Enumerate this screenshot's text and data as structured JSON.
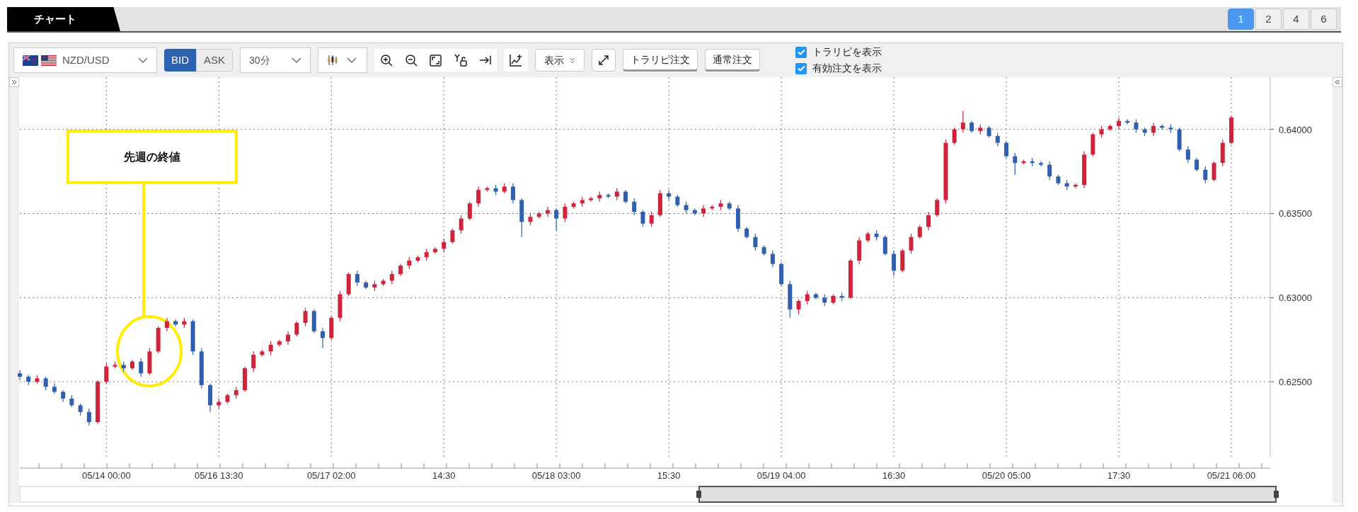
{
  "tab": {
    "label": "チャート"
  },
  "layout_buttons": [
    {
      "label": "1",
      "selected": true
    },
    {
      "label": "2",
      "selected": false
    },
    {
      "label": "4",
      "selected": false
    },
    {
      "label": "6",
      "selected": false
    }
  ],
  "toolbar": {
    "symbol": "NZD/USD",
    "price_side": [
      {
        "label": "BID",
        "selected": true
      },
      {
        "label": "ASK",
        "selected": false
      }
    ],
    "timeframe": "30分",
    "display_button": "表示",
    "order_buttons": [
      "トラリピ注文",
      "通常注文"
    ],
    "checkboxes": [
      {
        "label": "トラリピを表示",
        "checked": true
      },
      {
        "label": "有効注文を表示",
        "checked": true
      }
    ]
  },
  "chart": {
    "annotation": {
      "text": "先週の終値"
    },
    "chart_data": {
      "type": "candlestick",
      "ylim": [
        0.6205,
        0.6431
      ],
      "grid": true,
      "yticks": [
        {
          "value": 0.64,
          "label": "0.64000"
        },
        {
          "value": 0.635,
          "label": "0.63500"
        },
        {
          "value": 0.63,
          "label": "0.63000"
        },
        {
          "value": 0.625,
          "label": "0.62500"
        }
      ],
      "categories": [
        null,
        null,
        null,
        null,
        null,
        null,
        null,
        null,
        null,
        null,
        "05/14 00:00",
        null,
        null,
        null,
        null,
        null,
        null,
        null,
        null,
        null,
        null,
        null,
        null,
        "05/16 13:30",
        null,
        null,
        null,
        null,
        null,
        null,
        null,
        null,
        null,
        null,
        null,
        null,
        "05/17 02:00",
        null,
        null,
        null,
        null,
        null,
        null,
        null,
        null,
        null,
        null,
        null,
        null,
        "14:30",
        null,
        null,
        null,
        null,
        null,
        null,
        null,
        null,
        null,
        null,
        null,
        null,
        "05/18 03:00",
        null,
        null,
        null,
        null,
        null,
        null,
        null,
        null,
        null,
        null,
        null,
        null,
        "15:30",
        null,
        null,
        null,
        null,
        null,
        null,
        null,
        null,
        null,
        null,
        null,
        null,
        "05/19 04:00",
        null,
        null,
        null,
        null,
        null,
        null,
        null,
        null,
        null,
        null,
        null,
        null,
        "16:30",
        null,
        null,
        null,
        null,
        null,
        null,
        null,
        null,
        null,
        null,
        null,
        null,
        "05/20 05:00",
        null,
        null,
        null,
        null,
        null,
        null,
        null,
        null,
        null,
        null,
        null,
        null,
        "17:30",
        null,
        null,
        null,
        null,
        null,
        null,
        null,
        null,
        null,
        null,
        null,
        null,
        "05/21 06:00"
      ],
      "ohlc": [
        [
          0.6255,
          0.6257,
          0.6251,
          0.6253
        ],
        [
          0.6253,
          0.6254,
          0.6248,
          0.625
        ],
        [
          0.625,
          0.6254,
          0.6249,
          0.6252
        ],
        [
          0.6252,
          0.6253,
          0.6245,
          0.6247
        ],
        [
          0.6247,
          0.6249,
          0.6243,
          0.6244
        ],
        [
          0.6244,
          0.6245,
          0.6238,
          0.624
        ],
        [
          0.624,
          0.6242,
          0.6235,
          0.6236
        ],
        [
          0.6236,
          0.6237,
          0.623,
          0.6232
        ],
        [
          0.6232,
          0.6234,
          0.6224,
          0.6226
        ],
        [
          0.6226,
          0.6251,
          0.6225,
          0.625
        ],
        [
          0.625,
          0.6261,
          0.6249,
          0.6259
        ],
        [
          0.6259,
          0.6262,
          0.6258,
          0.626
        ],
        [
          0.626,
          0.6262,
          0.6256,
          0.6258
        ],
        [
          0.6258,
          0.6263,
          0.6257,
          0.6262
        ],
        [
          0.6262,
          0.6264,
          0.6253,
          0.6255
        ],
        [
          0.6255,
          0.627,
          0.6254,
          0.6268
        ],
        [
          0.6268,
          0.6283,
          0.6267,
          0.6282
        ],
        [
          0.6282,
          0.6288,
          0.628,
          0.6286
        ],
        [
          0.6286,
          0.6287,
          0.6283,
          0.6284
        ],
        [
          0.6284,
          0.6288,
          0.6282,
          0.6286
        ],
        [
          0.6286,
          0.6287,
          0.6266,
          0.6268
        ],
        [
          0.6268,
          0.627,
          0.6246,
          0.6248
        ],
        [
          0.6248,
          0.6249,
          0.6232,
          0.6236
        ],
        [
          0.6236,
          0.624,
          0.6234,
          0.6238
        ],
        [
          0.6238,
          0.6243,
          0.6237,
          0.6242
        ],
        [
          0.6242,
          0.6247,
          0.624,
          0.6245
        ],
        [
          0.6245,
          0.6259,
          0.6244,
          0.6258
        ],
        [
          0.6258,
          0.6268,
          0.6256,
          0.6266
        ],
        [
          0.6266,
          0.6269,
          0.6265,
          0.6268
        ],
        [
          0.6268,
          0.6274,
          0.6266,
          0.6272
        ],
        [
          0.6272,
          0.6275,
          0.6271,
          0.6274
        ],
        [
          0.6274,
          0.628,
          0.6272,
          0.6278
        ],
        [
          0.6278,
          0.6286,
          0.6277,
          0.6285
        ],
        [
          0.6285,
          0.6294,
          0.6283,
          0.6292
        ],
        [
          0.6292,
          0.6293,
          0.6279,
          0.628
        ],
        [
          0.628,
          0.6282,
          0.627,
          0.6276
        ],
        [
          0.6276,
          0.6289,
          0.6275,
          0.6288
        ],
        [
          0.6288,
          0.6304,
          0.6286,
          0.6302
        ],
        [
          0.6302,
          0.6315,
          0.6301,
          0.6314
        ],
        [
          0.6314,
          0.6316,
          0.6307,
          0.6309
        ],
        [
          0.6309,
          0.631,
          0.6305,
          0.6306
        ],
        [
          0.6306,
          0.631,
          0.6304,
          0.6308
        ],
        [
          0.6308,
          0.6311,
          0.6307,
          0.631
        ],
        [
          0.631,
          0.6316,
          0.6308,
          0.6314
        ],
        [
          0.6314,
          0.632,
          0.6313,
          0.6319
        ],
        [
          0.6319,
          0.6324,
          0.6317,
          0.6322
        ],
        [
          0.6322,
          0.6325,
          0.6321,
          0.6324
        ],
        [
          0.6324,
          0.6329,
          0.6322,
          0.6327
        ],
        [
          0.6327,
          0.633,
          0.6326,
          0.6329
        ],
        [
          0.6329,
          0.6335,
          0.6327,
          0.6333
        ],
        [
          0.6333,
          0.6341,
          0.6332,
          0.634
        ],
        [
          0.634,
          0.6349,
          0.6338,
          0.6347
        ],
        [
          0.6347,
          0.6357,
          0.6346,
          0.6356
        ],
        [
          0.6356,
          0.6366,
          0.6354,
          0.6364
        ],
        [
          0.6364,
          0.6366,
          0.6363,
          0.6365
        ],
        [
          0.6365,
          0.6367,
          0.6361,
          0.6363
        ],
        [
          0.6363,
          0.6368,
          0.6362,
          0.6366
        ],
        [
          0.6366,
          0.6368,
          0.6356,
          0.6358
        ],
        [
          0.6358,
          0.6359,
          0.6336,
          0.6345
        ],
        [
          0.6345,
          0.635,
          0.6343,
          0.6348
        ],
        [
          0.6348,
          0.6351,
          0.6347,
          0.635
        ],
        [
          0.635,
          0.6354,
          0.6348,
          0.6352
        ],
        [
          0.6352,
          0.6353,
          0.634,
          0.6347
        ],
        [
          0.6347,
          0.6356,
          0.6345,
          0.6354
        ],
        [
          0.6354,
          0.6357,
          0.6353,
          0.6356
        ],
        [
          0.6356,
          0.636,
          0.6354,
          0.6358
        ],
        [
          0.6358,
          0.636,
          0.6357,
          0.6359
        ],
        [
          0.6359,
          0.6363,
          0.6357,
          0.6361
        ],
        [
          0.6361,
          0.6362,
          0.6359,
          0.636
        ],
        [
          0.636,
          0.6365,
          0.6358,
          0.6363
        ],
        [
          0.6363,
          0.6364,
          0.6356,
          0.6357
        ],
        [
          0.6357,
          0.6359,
          0.6349,
          0.6351
        ],
        [
          0.6351,
          0.6352,
          0.6342,
          0.6344
        ],
        [
          0.6344,
          0.6351,
          0.6342,
          0.6349
        ],
        [
          0.6349,
          0.6364,
          0.6348,
          0.6362
        ],
        [
          0.6362,
          0.6364,
          0.6358,
          0.636
        ],
        [
          0.636,
          0.6361,
          0.6354,
          0.6355
        ],
        [
          0.6355,
          0.6357,
          0.635,
          0.6352
        ],
        [
          0.6352,
          0.6353,
          0.6349,
          0.635
        ],
        [
          0.635,
          0.6355,
          0.6348,
          0.6353
        ],
        [
          0.6353,
          0.6355,
          0.6352,
          0.6354
        ],
        [
          0.6354,
          0.6358,
          0.6352,
          0.6356
        ],
        [
          0.6356,
          0.6357,
          0.6352,
          0.6353
        ],
        [
          0.6353,
          0.6355,
          0.6339,
          0.6341
        ],
        [
          0.6341,
          0.6342,
          0.6335,
          0.6336
        ],
        [
          0.6336,
          0.6338,
          0.6328,
          0.633
        ],
        [
          0.633,
          0.6331,
          0.6325,
          0.6326
        ],
        [
          0.6326,
          0.6328,
          0.6318,
          0.632
        ],
        [
          0.632,
          0.6321,
          0.6307,
          0.6308
        ],
        [
          0.6308,
          0.631,
          0.6288,
          0.6293
        ],
        [
          0.6293,
          0.6299,
          0.629,
          0.6298
        ],
        [
          0.6298,
          0.6304,
          0.6296,
          0.6302
        ],
        [
          0.6302,
          0.6303,
          0.6299,
          0.63
        ],
        [
          0.63,
          0.6302,
          0.6295,
          0.6297
        ],
        [
          0.6297,
          0.6302,
          0.6296,
          0.6301
        ],
        [
          0.6301,
          0.6303,
          0.6298,
          0.63
        ],
        [
          0.63,
          0.6323,
          0.6299,
          0.6322
        ],
        [
          0.6322,
          0.6336,
          0.632,
          0.6334
        ],
        [
          0.6334,
          0.6339,
          0.6333,
          0.6338
        ],
        [
          0.6338,
          0.634,
          0.6334,
          0.6336
        ],
        [
          0.6336,
          0.6337,
          0.6325,
          0.6326
        ],
        [
          0.6326,
          0.6328,
          0.6313,
          0.6316
        ],
        [
          0.6316,
          0.6329,
          0.6315,
          0.6328
        ],
        [
          0.6328,
          0.6338,
          0.6326,
          0.6336
        ],
        [
          0.6336,
          0.6343,
          0.6335,
          0.6342
        ],
        [
          0.6342,
          0.6351,
          0.634,
          0.6349
        ],
        [
          0.6349,
          0.6359,
          0.6348,
          0.6358
        ],
        [
          0.6358,
          0.6394,
          0.6356,
          0.6392
        ],
        [
          0.6392,
          0.6401,
          0.6391,
          0.64
        ],
        [
          0.64,
          0.6411,
          0.6398,
          0.6404
        ],
        [
          0.6404,
          0.6405,
          0.6398,
          0.6399
        ],
        [
          0.6399,
          0.6403,
          0.6397,
          0.6401
        ],
        [
          0.6401,
          0.6402,
          0.6395,
          0.6396
        ],
        [
          0.6396,
          0.6398,
          0.639,
          0.6392
        ],
        [
          0.6392,
          0.6393,
          0.6383,
          0.6384
        ],
        [
          0.6384,
          0.6386,
          0.6373,
          0.638
        ],
        [
          0.638,
          0.6382,
          0.6379,
          0.6381
        ],
        [
          0.6381,
          0.6383,
          0.6378,
          0.638
        ],
        [
          0.638,
          0.6381,
          0.6378,
          0.6379
        ],
        [
          0.6379,
          0.6381,
          0.637,
          0.6372
        ],
        [
          0.6372,
          0.6373,
          0.6367,
          0.6368
        ],
        [
          0.6368,
          0.637,
          0.6364,
          0.6366
        ],
        [
          0.6366,
          0.6368,
          0.6365,
          0.6367
        ],
        [
          0.6367,
          0.6387,
          0.6365,
          0.6385
        ],
        [
          0.6385,
          0.6398,
          0.6384,
          0.6397
        ],
        [
          0.6397,
          0.6402,
          0.6395,
          0.64
        ],
        [
          0.64,
          0.6403,
          0.6399,
          0.6402
        ],
        [
          0.6402,
          0.6407,
          0.64,
          0.6405
        ],
        [
          0.6405,
          0.6406,
          0.6403,
          0.6404
        ],
        [
          0.6404,
          0.6406,
          0.6398,
          0.64
        ],
        [
          0.64,
          0.6401,
          0.6396,
          0.6398
        ],
        [
          0.6398,
          0.6404,
          0.6396,
          0.6402
        ],
        [
          0.6402,
          0.6403,
          0.64,
          0.6401
        ],
        [
          0.6401,
          0.6403,
          0.6398,
          0.64
        ],
        [
          0.64,
          0.6401,
          0.6387,
          0.6388
        ],
        [
          0.6388,
          0.639,
          0.638,
          0.6382
        ],
        [
          0.6382,
          0.6383,
          0.6375,
          0.6376
        ],
        [
          0.6376,
          0.6378,
          0.6368,
          0.637
        ],
        [
          0.637,
          0.6381,
          0.6369,
          0.638
        ],
        [
          0.638,
          0.6394,
          0.6378,
          0.6392
        ],
        [
          0.6392,
          0.6408,
          0.6391,
          0.6407
        ]
      ]
    }
  }
}
